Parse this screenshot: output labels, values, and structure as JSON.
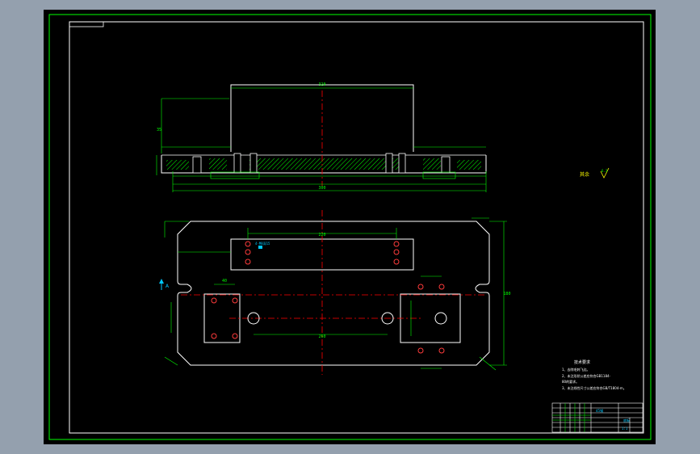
{
  "drawing": {
    "tech_requirements": {
      "title": "技术要求",
      "lines": [
        "1、去除毛刺飞边。",
        "2、未注形状公差应符合GB1184-",
        "    80的要求。",
        "3、未注线性尺寸公差应符合GB/T1804-m。"
      ]
    },
    "roughness_note": "其余",
    "roughness_symbol": "6.3",
    "section_label": "A",
    "title_block": {
      "material": "45钢",
      "part_name": "底板",
      "scale": "1:1"
    },
    "dimensions": {
      "top_overall": "320",
      "top_height": "35",
      "top_width": "300",
      "plan_slot": "220",
      "plan_holes": "260",
      "plan_height": "180",
      "plan_tab": "40",
      "callout": "4-M8深15"
    }
  },
  "colors": {
    "background": "#000000",
    "frame": "#ffffff",
    "outline": "#ffffff",
    "dimension": "#00ff00",
    "centerline": "#ff0000",
    "hatch": "#00ff00",
    "hole": "#ff3b3b",
    "text_note": "#ffffff",
    "note_highlight": "#ffff00",
    "callout": "#00c8ff"
  }
}
